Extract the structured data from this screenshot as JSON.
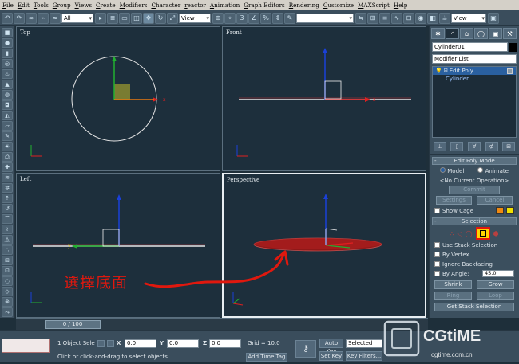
{
  "menu": [
    "File",
    "Edit",
    "Tools",
    "Group",
    "Views",
    "Create",
    "Modifiers",
    "Character",
    "reactor",
    "Animation",
    "Graph Editors",
    "Rendering",
    "Customize",
    "MAXScript",
    "Help"
  ],
  "toolbar": {
    "filter_value": "All",
    "refcoord_value": "View",
    "right_coord_value": "View"
  },
  "viewports": {
    "top": "Top",
    "front": "Front",
    "left": "Left",
    "perspective": "Perspective"
  },
  "annotation": "選擇底面",
  "command_panel": {
    "object_name": "Cylinder01",
    "modifier_list": "Modifier List",
    "stack": [
      "Edit Poly",
      "Cylinder"
    ],
    "edit_poly_mode": {
      "title": "Edit Poly Mode",
      "model": "Model",
      "animate": "Animate",
      "no_op": "<No Current Operation>",
      "commit": "Commit",
      "settings": "Settings",
      "cancel": "Cancel",
      "show_cage": "Show Cage"
    },
    "selection": {
      "title": "Selection",
      "use_stack": "Use Stack Selection",
      "by_vertex": "By Vertex",
      "ignore_backfacing": "Ignore Backfacing",
      "by_angle": "By Angle:",
      "angle_value": "45.0",
      "shrink": "Shrink",
      "grow": "Grow",
      "ring": "Ring",
      "loop": "Loop",
      "get_stack": "Get Stack Selection"
    }
  },
  "timeline": {
    "frame": "0 / 100"
  },
  "status": {
    "selected_count": "1 Object Sele",
    "x": "0.0",
    "y": "0.0",
    "z": "0.0",
    "grid": "Grid = 10.0",
    "add_time_tag": "Add Time Tag",
    "prompt": "Click or click-and-drag to select objects",
    "auto_key": "Auto Key",
    "set_key": "Set Key",
    "selected_dropdown": "Selected",
    "key_filters": "Key Filters..."
  },
  "watermark": {
    "brand": "CGtiME",
    "url": "cgtime.com.cn"
  },
  "colors": {
    "accent_red": "#e0180e",
    "selected_yellow": "#ffd400",
    "viewport_bg": "#1d2f3c"
  }
}
